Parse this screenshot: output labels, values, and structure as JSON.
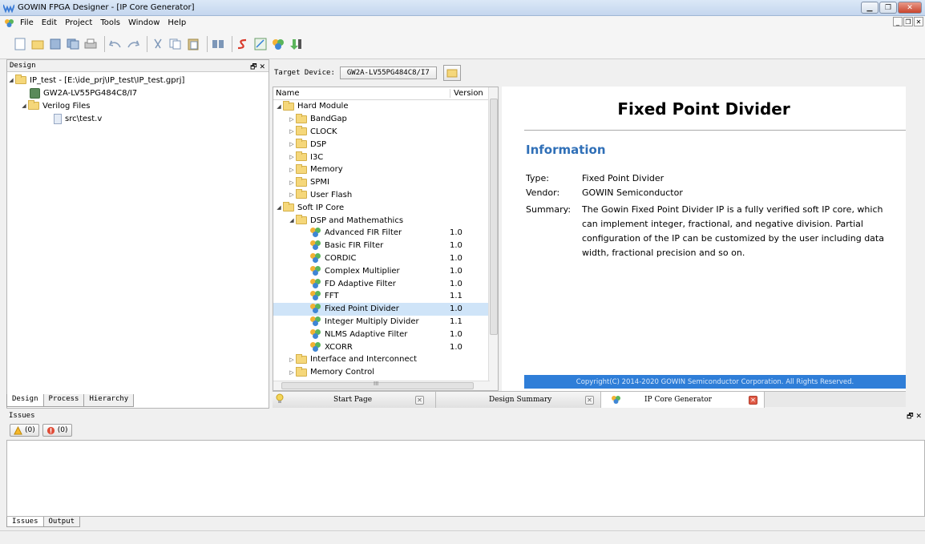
{
  "window": {
    "title": "GOWIN FPGA Designer - [IP Core Generator]"
  },
  "menu": [
    "File",
    "Edit",
    "Project",
    "Tools",
    "Window",
    "Help"
  ],
  "design_panel": {
    "title": "Design",
    "project": "IP_test - [E:\\ide_prj\\IP_test\\IP_test.gprj]",
    "device": "GW2A-LV55PG484C8/I7",
    "verilog_folder": "Verilog Files",
    "file": "src\\test.v",
    "tabs": [
      "Design",
      "Process",
      "Hierarchy"
    ]
  },
  "target": {
    "label": "Target Device:",
    "device": "GW2A-LV55PG484C8/I7"
  },
  "ip_tree": {
    "col_name": "Name",
    "col_version": "Version",
    "hard_module": "Hard Module",
    "hard_items": [
      "BandGap",
      "CLOCK",
      "DSP",
      "I3C",
      "Memory",
      "SPMI",
      "User Flash"
    ],
    "soft_ip": "Soft IP Core",
    "dsp_math": "DSP and Mathemathics",
    "soft_items": [
      {
        "name": "Advanced FIR Filter",
        "version": "1.0"
      },
      {
        "name": "Basic FIR Filter",
        "version": "1.0"
      },
      {
        "name": "CORDIC",
        "version": "1.0"
      },
      {
        "name": "Complex Multiplier",
        "version": "1.0"
      },
      {
        "name": "FD Adaptive Filter",
        "version": "1.0"
      },
      {
        "name": "FFT",
        "version": "1.1"
      },
      {
        "name": "Fixed Point Divider",
        "version": "1.0"
      },
      {
        "name": "Integer Multiply Divider",
        "version": "1.1"
      },
      {
        "name": "NLMS Adaptive Filter",
        "version": "1.0"
      },
      {
        "name": "XCORR",
        "version": "1.0"
      }
    ],
    "interface": "Interface and Interconnect",
    "memory_control": "Memory Control",
    "hscroll_mark": "III"
  },
  "info": {
    "title": "Fixed Point Divider",
    "section": "Information",
    "type_label": "Type:",
    "type_value": "Fixed Point Divider",
    "vendor_label": "Vendor:",
    "vendor_value": "GOWIN Semiconductor",
    "summary_label": "Summary:",
    "summary_value": "The Gowin Fixed Point Divider IP is a fully verified soft IP core, which can implement integer, fractional, and negative division. Partial configuration of the IP can be customized by the user including data width, fractional precision and so on.",
    "copyright": "Copyright(C) 2014-2020 GOWIN Semiconductor Corporation. All Rights Reserved."
  },
  "doc_tabs": [
    "Start Page",
    "Design Summary",
    "IP Core Generator"
  ],
  "issues": {
    "title": "Issues",
    "warnings": "(0)",
    "errors": "(0)",
    "tabs": [
      "Issues",
      "Output"
    ]
  }
}
